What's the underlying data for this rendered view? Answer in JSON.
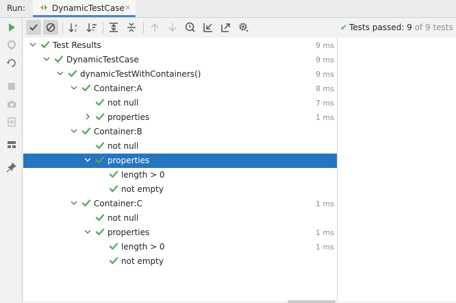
{
  "run": {
    "label": "Run:",
    "tab_title": "DynamicTestCase",
    "tab_close": "×"
  },
  "status": {
    "prefix": "Tests passed:",
    "passed": "9",
    "suffix": "of 9 tests –"
  },
  "toolbar": {
    "buttons": [
      "run-icon",
      "show-passed-icon",
      "show-ignored-icon",
      "sort-alpha-icon",
      "sort-duration-icon",
      "expand-all-icon",
      "collapse-all-icon",
      "prev-failed-icon",
      "next-failed-icon",
      "history-icon",
      "import-tests-icon",
      "export-tests-icon",
      "settings-icon"
    ]
  },
  "tree": [
    {
      "label": "Test Results",
      "time": "9 ms",
      "depth": 0,
      "arrow": "down",
      "selected": false
    },
    {
      "label": "DynamicTestCase",
      "time": "9 ms",
      "depth": 1,
      "arrow": "down",
      "selected": false
    },
    {
      "label": "dynamicTestWithContainers()",
      "time": "9 ms",
      "depth": 2,
      "arrow": "down",
      "selected": false
    },
    {
      "label": "Container:A",
      "time": "8 ms",
      "depth": 3,
      "arrow": "down",
      "selected": false
    },
    {
      "label": "not null",
      "time": "7 ms",
      "depth": 4,
      "arrow": "none",
      "selected": false
    },
    {
      "label": "properties",
      "time": "1 ms",
      "depth": 4,
      "arrow": "right",
      "selected": false
    },
    {
      "label": "Container:B",
      "time": "",
      "depth": 3,
      "arrow": "down",
      "selected": false
    },
    {
      "label": "not null",
      "time": "",
      "depth": 4,
      "arrow": "none",
      "selected": false
    },
    {
      "label": "properties",
      "time": "",
      "depth": 4,
      "arrow": "down",
      "selected": true
    },
    {
      "label": "length > 0",
      "time": "",
      "depth": 5,
      "arrow": "none",
      "selected": false
    },
    {
      "label": "not empty",
      "time": "",
      "depth": 5,
      "arrow": "none",
      "selected": false
    },
    {
      "label": "Container:C",
      "time": "1 ms",
      "depth": 3,
      "arrow": "down",
      "selected": false
    },
    {
      "label": "not null",
      "time": "",
      "depth": 4,
      "arrow": "none",
      "selected": false
    },
    {
      "label": "properties",
      "time": "1 ms",
      "depth": 4,
      "arrow": "down",
      "selected": false
    },
    {
      "label": "length > 0",
      "time": "1 ms",
      "depth": 5,
      "arrow": "none",
      "selected": false
    },
    {
      "label": "not empty",
      "time": "",
      "depth": 5,
      "arrow": "none",
      "selected": false
    }
  ],
  "colors": {
    "pass": "#59a869",
    "selection": "#2675bf",
    "accent": "#4a86c7"
  }
}
